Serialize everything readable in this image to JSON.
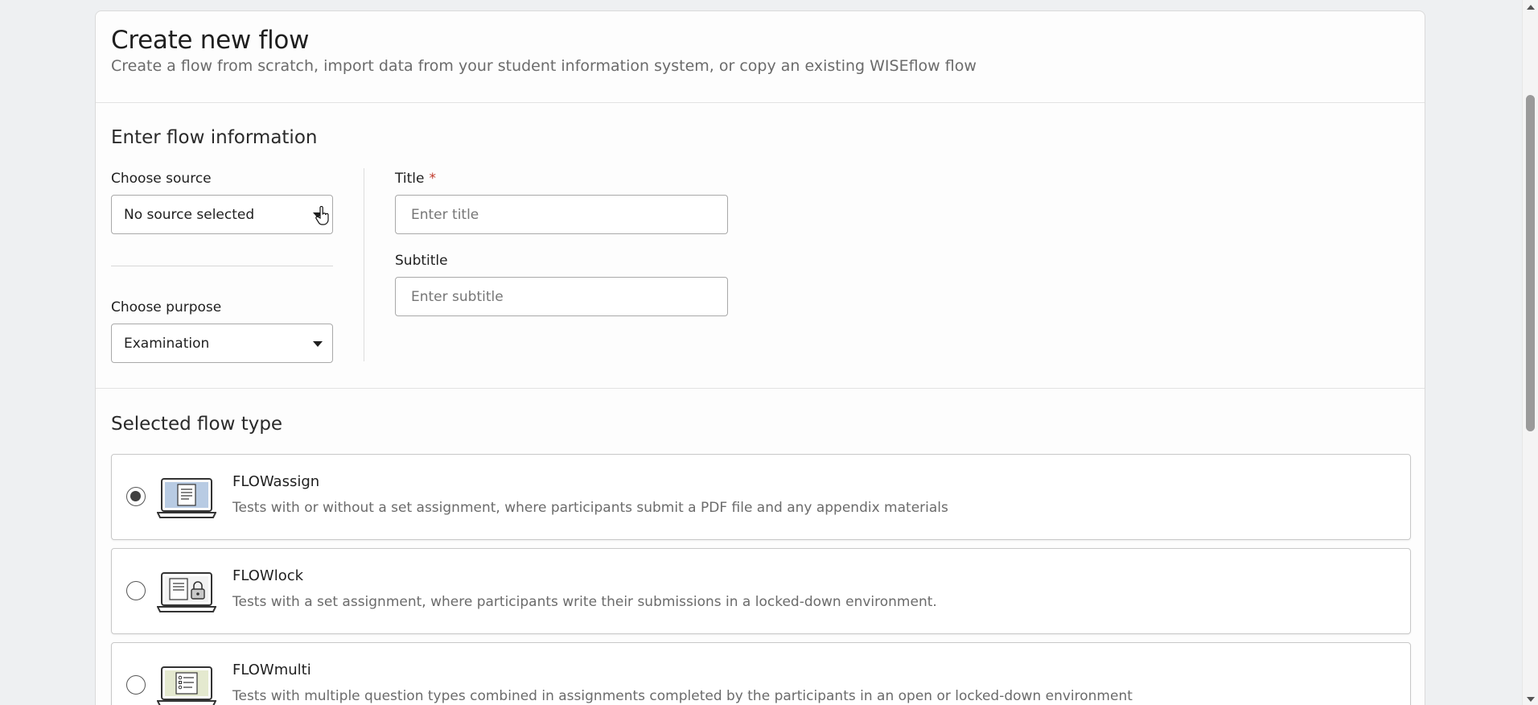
{
  "header": {
    "title": "Create new flow",
    "subtitle": "Create a flow from scratch, import data from your student information system, or copy an existing WISEflow flow"
  },
  "flow_info": {
    "section_title": "Enter flow information",
    "source": {
      "label": "Choose source",
      "value": "No source selected"
    },
    "purpose": {
      "label": "Choose purpose",
      "value": "Examination"
    },
    "title_field": {
      "label": "Title",
      "required_mark": "*",
      "placeholder": "Enter title",
      "value": ""
    },
    "subtitle_field": {
      "label": "Subtitle",
      "placeholder": "Enter subtitle",
      "value": ""
    }
  },
  "flow_type": {
    "section_title": "Selected flow type",
    "options": [
      {
        "name": "FLOWassign",
        "description": "Tests with or without a set assignment, where participants submit a PDF file and any appendix materials",
        "selected": true,
        "icon": "laptop-document-icon"
      },
      {
        "name": "FLOWlock",
        "description": "Tests with a set assignment, where participants write their submissions in a locked-down environment.",
        "selected": false,
        "icon": "laptop-lock-icon"
      },
      {
        "name": "FLOWmulti",
        "description": "Tests with multiple question types combined in assignments completed by the participants in an open or locked-down environment",
        "selected": false,
        "icon": "laptop-checklist-icon"
      }
    ]
  },
  "colors": {
    "required": "#c0392b",
    "laptop_screen_assign": "#b8cbe3",
    "laptop_screen_multi": "#e4e9cf"
  }
}
